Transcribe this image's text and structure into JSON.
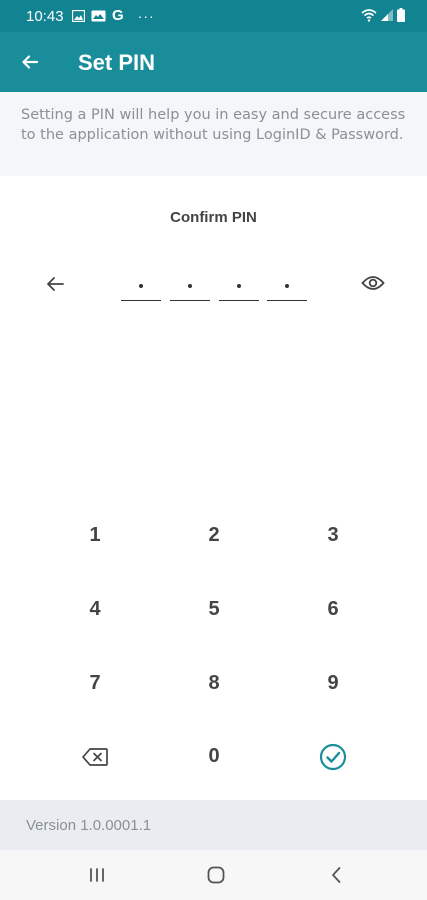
{
  "status_bar": {
    "time": "10:43",
    "letter": "G",
    "more": "···"
  },
  "app_bar": {
    "title": "Set PIN"
  },
  "info": {
    "text": "Setting a PIN will help you in easy and secure access to the application without using LoginID & Password."
  },
  "pin": {
    "label": "Confirm PIN",
    "dots": [
      "•",
      "•",
      "•",
      "•"
    ]
  },
  "keypad": {
    "keys": [
      "1",
      "2",
      "3",
      "4",
      "5",
      "6",
      "7",
      "8",
      "9",
      "0"
    ]
  },
  "footer": {
    "version": "Version 1.0.0001.1"
  },
  "colors": {
    "status_bar": "#128390",
    "app_bar": "#1a8d9b",
    "accent": "#1a8d9b"
  }
}
